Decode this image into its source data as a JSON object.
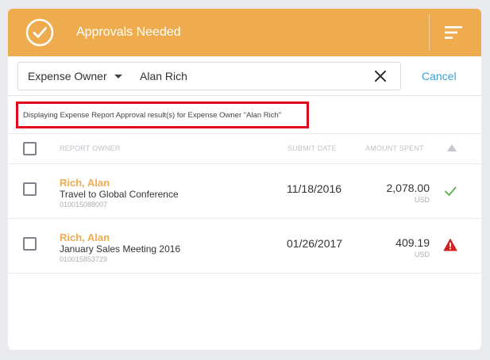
{
  "header": {
    "title": "Approvals Needed",
    "accent_color": "#efac4f",
    "left_icon": "check-circle-icon",
    "right_icon": "menu-icon"
  },
  "search": {
    "filter_label": "Expense Owner",
    "value": "Alan Rich",
    "clear_icon": "close-icon",
    "cancel_label": "Cancel"
  },
  "notice": "Displaying Expense Report Approval result(s) for Expense Owner \"Alan Rich\"",
  "table": {
    "headers": {
      "owner": "REPORT OWNER",
      "date": "SUBMIT DATE",
      "amount": "AMOUNT SPENT"
    },
    "rows": [
      {
        "owner": "Rich, Alan",
        "report": "Travel to Global Conference",
        "id": "010015088007",
        "date": "11/18/2016",
        "amount": "2,078.00",
        "currency": "USD",
        "status": "ok-check-icon"
      },
      {
        "owner": "Rich, Alan",
        "report": "January Sales Meeting 2016",
        "id": "010015853729",
        "date": "01/26/2017",
        "amount": "409.19",
        "currency": "USD",
        "status": "warning-icon"
      }
    ]
  }
}
